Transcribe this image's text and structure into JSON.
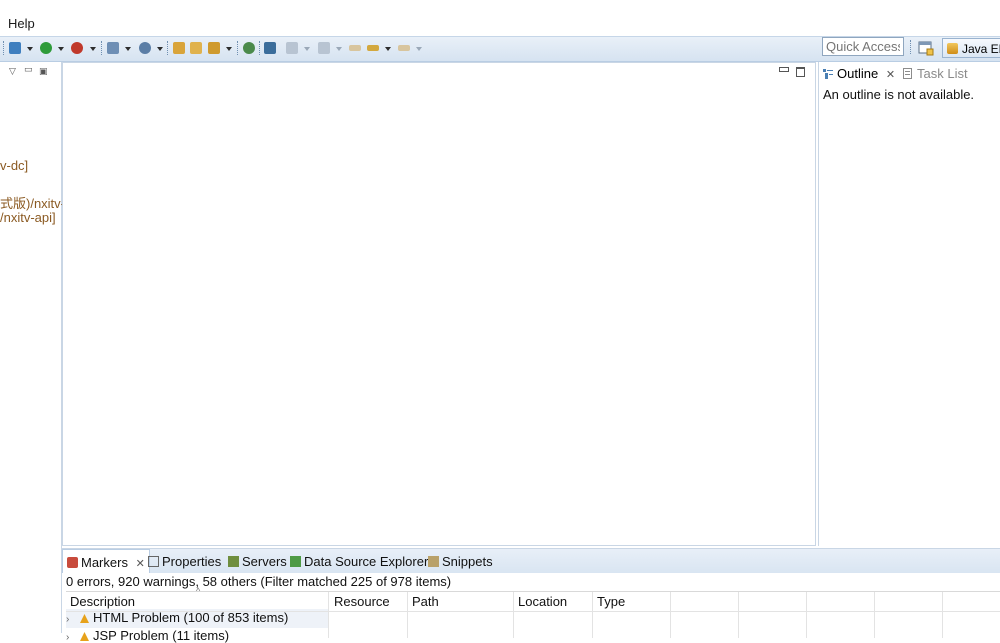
{
  "menubar": {
    "help_label": "Help"
  },
  "toolbar": {
    "quick_access_placeholder": "Quick Access",
    "perspective_label": "Java EE"
  },
  "left_panel": {
    "tree_lines": [
      "v-dc]",
      "式版)/nxitv-a",
      "/nxitv-api]"
    ]
  },
  "outline": {
    "outline_tab": "Outline",
    "task_tab": "Task List",
    "message": "An outline is not available."
  },
  "bottom": {
    "tabs": [
      "Markers",
      "Properties",
      "Servers",
      "Data Source Explorer",
      "Snippets"
    ],
    "summary": "0 errors, 920 warnings, 58 others (Filter matched 225 of 978 items)",
    "columns": [
      "Description",
      "Resource",
      "Path",
      "Location",
      "Type"
    ],
    "rows": [
      "HTML Problem (100 of 853 items)",
      "JSP Problem (11 items)"
    ]
  },
  "colors": {
    "toolbar_bg": "#d6e3f1",
    "accent_border": "#b9cde3",
    "tree_text": "#8b5a22",
    "warning": "#e7a21b"
  }
}
